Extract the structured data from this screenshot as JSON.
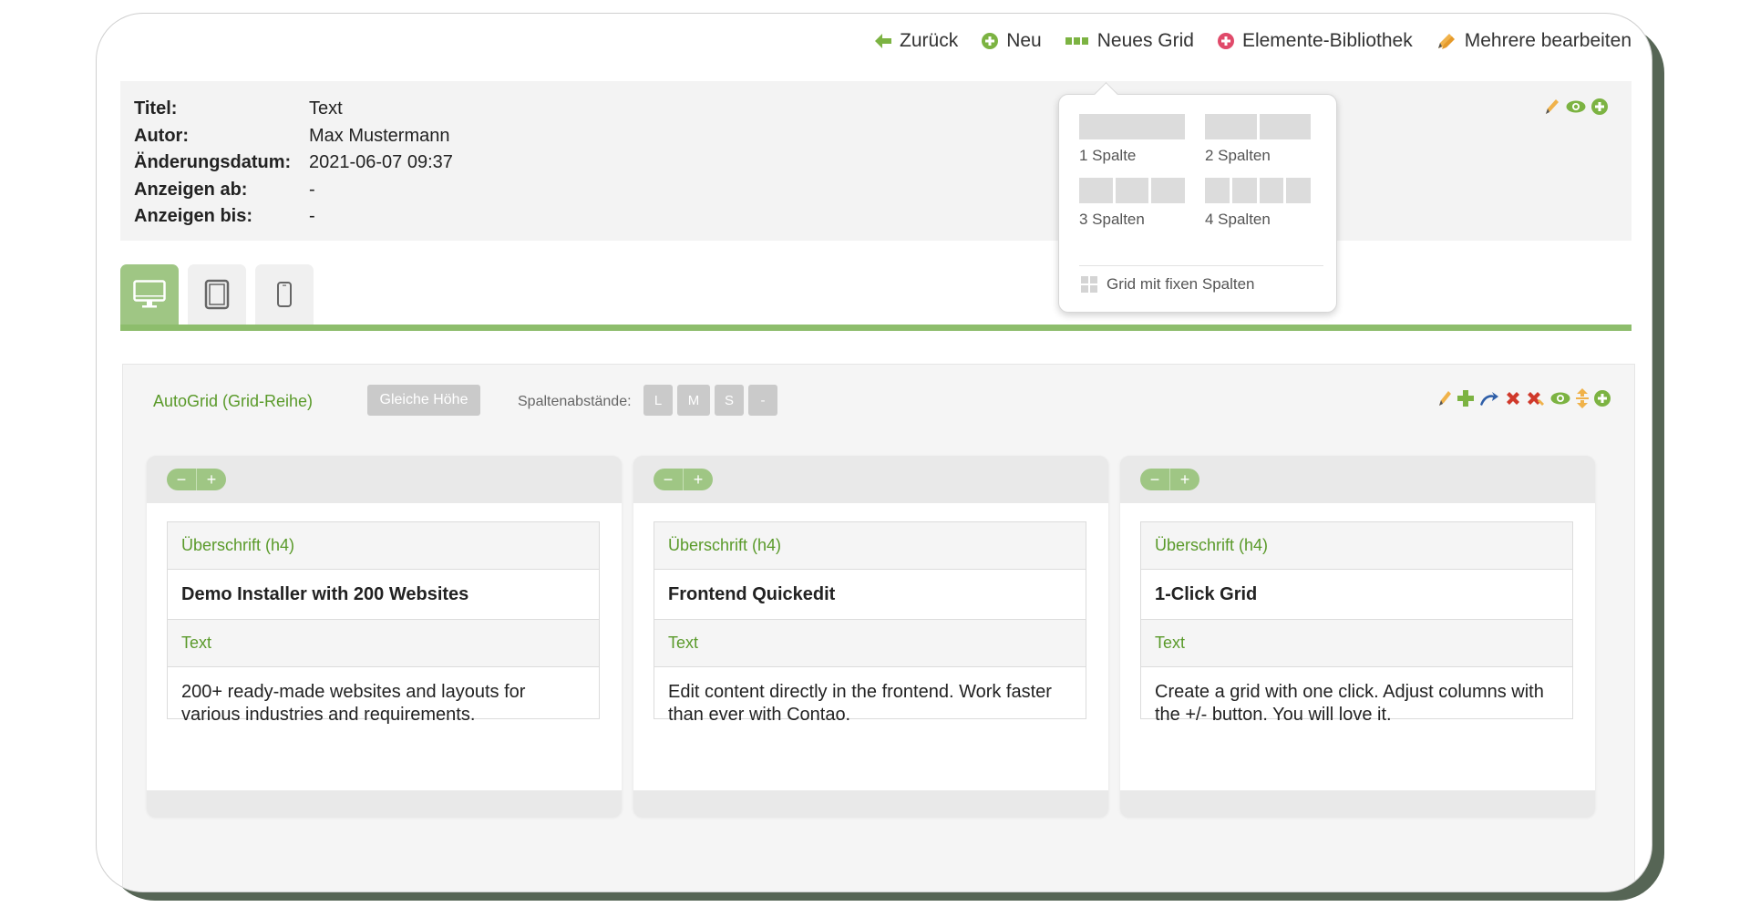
{
  "toolbar": {
    "back": "Zurück",
    "new": "Neu",
    "new_grid": "Neues Grid",
    "library": "Elemente-Bibliothek",
    "edit_multiple": "Mehrere bearbeiten"
  },
  "info": {
    "rows": [
      {
        "key": "Titel:",
        "value": "Text"
      },
      {
        "key": "Autor:",
        "value": "Max Mustermann"
      },
      {
        "key": "Änderungsdatum:",
        "value": "2021-06-07 09:37"
      },
      {
        "key": "Anzeigen ab:",
        "value": "-"
      },
      {
        "key": "Anzeigen bis:",
        "value": "-"
      }
    ]
  },
  "dropdown": {
    "options": [
      {
        "label": "1 Spalte",
        "cols": 1
      },
      {
        "label": "2 Spalten",
        "cols": 2
      },
      {
        "label": "3 Spalten",
        "cols": 3
      },
      {
        "label": "4 Spalten",
        "cols": 4
      }
    ],
    "fixed": "Grid mit fixen Spalten"
  },
  "grid": {
    "title": "AutoGrid (Grid-Reihe)",
    "equal_height": "Gleiche Höhe",
    "spacing_label": "Spaltenabstände:",
    "spacing_options": [
      "L",
      "M",
      "S",
      "-"
    ],
    "columns": [
      {
        "heading_type": "Überschrift (h4)",
        "heading": "Demo Installer with 200 Websites",
        "text_type": "Text",
        "text": "200+ ready-made websites and layouts for various industries and requirements."
      },
      {
        "heading_type": "Überschrift (h4)",
        "heading": "Frontend Quickedit",
        "text_type": "Text",
        "text": "Edit content directly in the frontend. Work faster than ever with Contao."
      },
      {
        "heading_type": "Überschrift (h4)",
        "heading": "1-Click Grid",
        "text_type": "Text",
        "text": "Create a grid with one click. Adjust columns with the +/- button. You will love it."
      }
    ],
    "minus": "−",
    "plus": "+"
  },
  "colors": {
    "accent": "#8dbd6c",
    "green_text": "#5a9a2a",
    "frame_shadow": "#566555"
  }
}
